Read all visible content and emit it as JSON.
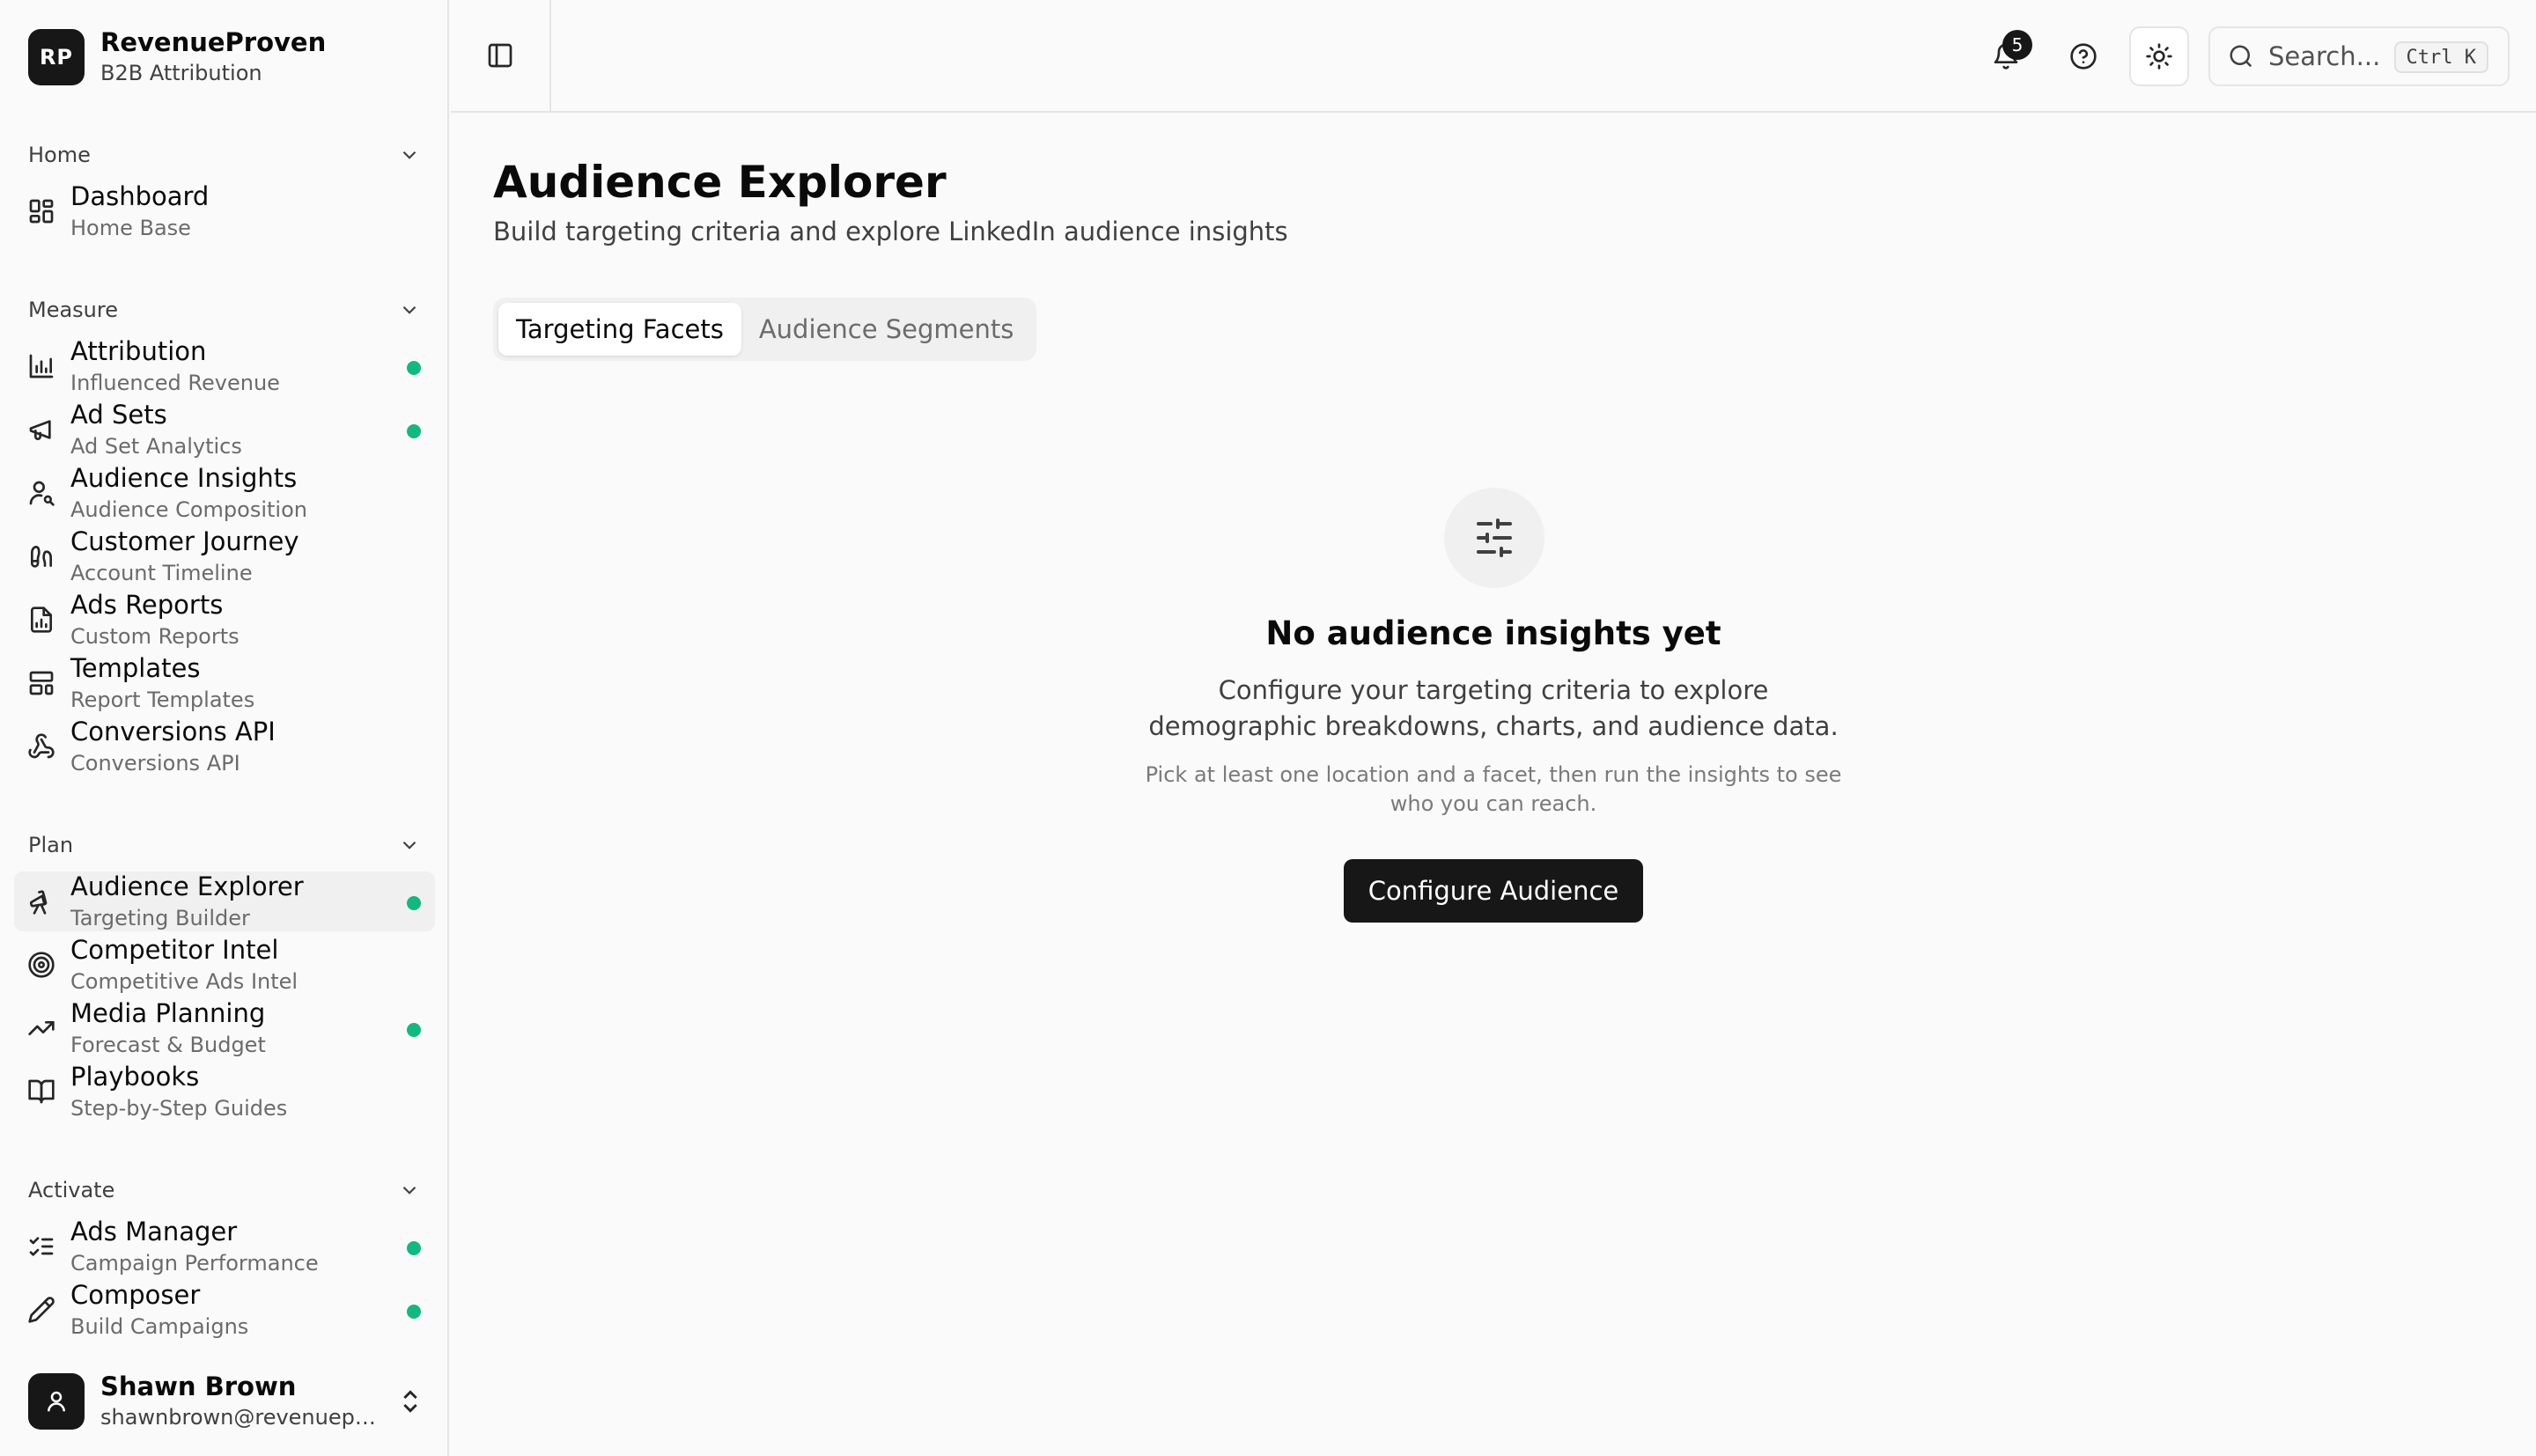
{
  "brand": {
    "initials": "RP",
    "name": "RevenueProven",
    "subtitle": "B2B Attribution"
  },
  "sidebar": {
    "groups": [
      {
        "label": "Home",
        "items": [
          {
            "title": "Dashboard",
            "subtitle": "Home Base",
            "icon": "grid-icon",
            "dot": false
          }
        ]
      },
      {
        "label": "Measure",
        "items": [
          {
            "title": "Attribution",
            "subtitle": "Influenced Revenue",
            "icon": "bar-chart-icon",
            "dot": true
          },
          {
            "title": "Ad Sets",
            "subtitle": "Ad Set Analytics",
            "icon": "megaphone-icon",
            "dot": true
          },
          {
            "title": "Audience Insights",
            "subtitle": "Audience Composition",
            "icon": "user-search-icon",
            "dot": false
          },
          {
            "title": "Customer Journey",
            "subtitle": "Account Timeline",
            "icon": "footprints-icon",
            "dot": false
          },
          {
            "title": "Ads Reports",
            "subtitle": "Custom Reports",
            "icon": "file-chart-icon",
            "dot": false
          },
          {
            "title": "Templates",
            "subtitle": "Report Templates",
            "icon": "layout-template-icon",
            "dot": false
          },
          {
            "title": "Conversions API",
            "subtitle": "Conversions API",
            "icon": "webhook-icon",
            "dot": false
          }
        ]
      },
      {
        "label": "Plan",
        "items": [
          {
            "title": "Audience Explorer",
            "subtitle": "Targeting Builder",
            "icon": "telescope-icon",
            "dot": true,
            "active": true
          },
          {
            "title": "Competitor Intel",
            "subtitle": "Competitive Ads Intel",
            "icon": "target-icon",
            "dot": false
          },
          {
            "title": "Media Planning",
            "subtitle": "Forecast & Budget",
            "icon": "trending-up-icon",
            "dot": true
          },
          {
            "title": "Playbooks",
            "subtitle": "Step-by-Step Guides",
            "icon": "book-open-icon",
            "dot": false
          }
        ]
      },
      {
        "label": "Activate",
        "items": [
          {
            "title": "Ads Manager",
            "subtitle": "Campaign Performance",
            "icon": "list-checks-icon",
            "dot": true
          },
          {
            "title": "Composer",
            "subtitle": "Build Campaigns",
            "icon": "pencil-icon",
            "dot": true
          }
        ]
      }
    ]
  },
  "user": {
    "name": "Shawn Brown",
    "email": "shawnbrown@revenueproven.com"
  },
  "header": {
    "notification_count": "5",
    "search_placeholder": "Search...",
    "search_shortcut": "Ctrl K"
  },
  "main": {
    "title": "Audience Explorer",
    "subtitle": "Build targeting criteria and explore LinkedIn audience insights",
    "tabs": [
      {
        "label": "Targeting Facets",
        "active": true
      },
      {
        "label": "Audience Segments",
        "active": false
      }
    ],
    "empty_state": {
      "title": "No audience insights yet",
      "description": "Configure your targeting criteria to explore demographic breakdowns, charts, and audience data.",
      "hint": "Pick at least one location and a facet, then run the insights to see who you can reach.",
      "cta_label": "Configure Audience"
    }
  },
  "colors": {
    "accent_dark": "#171717",
    "status_dot": "#10b981",
    "border": "#e5e5e5"
  }
}
